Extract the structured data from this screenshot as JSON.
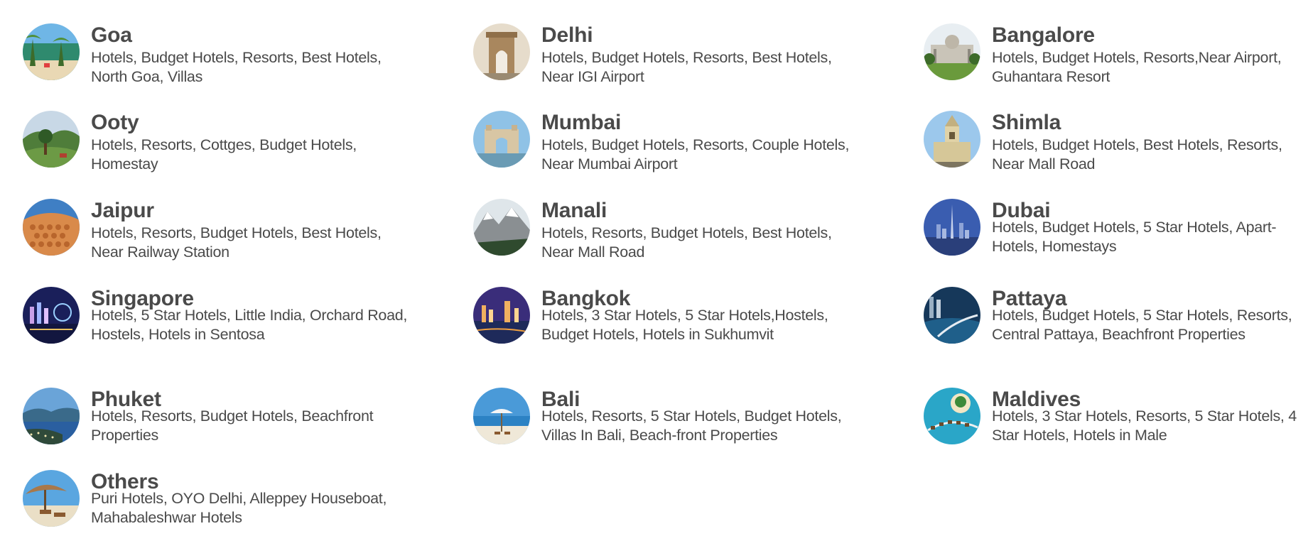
{
  "destinations": [
    {
      "name": "Goa",
      "links": "Hotels, Budget Hotels, Resorts, Best Hotels, North Goa, Villas"
    },
    {
      "name": "Delhi",
      "links": "Hotels, Budget Hotels, Resorts, Best Hotels, Near IGI Airport"
    },
    {
      "name": "Bangalore",
      "links": "Hotels, Budget Hotels, Resorts,Near Airport, Guhantara Resort"
    },
    {
      "name": "Ooty",
      "links": "Hotels, Resorts, Cottges, Budget Hotels, Homestay"
    },
    {
      "name": "Mumbai",
      "links": "Hotels, Budget Hotels, Resorts, Couple Hotels, Near Mumbai Airport"
    },
    {
      "name": "Shimla",
      "links": "Hotels, Budget Hotels, Best Hotels, Resorts, Near Mall Road"
    },
    {
      "name": "Jaipur",
      "links": "Hotels, Resorts, Budget Hotels, Best Hotels, Near Railway Station"
    },
    {
      "name": "Manali",
      "links": "Hotels, Resorts, Budget Hotels, Best Hotels, Near Mall Road"
    },
    {
      "name": "Dubai",
      "links": "Hotels, Budget Hotels, 5 Star Hotels, Apart-Hotels, Homestays"
    },
    {
      "name": "Singapore",
      "links": "Hotels, 5 Star Hotels, Little India, Orchard Road, Hostels, Hotels in Sentosa"
    },
    {
      "name": "Bangkok",
      "links": "Hotels, 3 Star Hotels, 5 Star Hotels,Hostels, Budget Hotels, Hotels in Sukhumvit"
    },
    {
      "name": "Pattaya",
      "links": "Hotels, Budget Hotels, 5 Star Hotels, Resorts, Central Pattaya, Beachfront Properties"
    },
    {
      "name": "Phuket",
      "links": "Hotels, Resorts, Budget Hotels, Beachfront Properties"
    },
    {
      "name": "Bali",
      "links": "Hotels, Resorts, 5 Star Hotels, Budget Hotels, Villas In Bali, Beach-front Properties"
    },
    {
      "name": "Maldives",
      "links": "Hotels, 3 Star Hotels, Resorts, 5 Star Hotels, 4 Star Hotels, Hotels in Male"
    },
    {
      "name": "Others",
      "links": "Puri Hotels, OYO Delhi, Alleppey Houseboat, Mahabaleshwar Hotels"
    }
  ],
  "colors": {
    "text": "#4a4a4a",
    "background": "#ffffff"
  },
  "icons": [
    "goa-beach-icon",
    "india-gate-icon",
    "palace-icon",
    "ooty-hills-icon",
    "gateway-of-india-icon",
    "shimla-church-icon",
    "hawa-mahal-icon",
    "snow-mountain-icon",
    "dubai-skyline-icon",
    "singapore-marina-icon",
    "bangkok-night-icon",
    "pattaya-coast-icon",
    "phuket-bay-icon",
    "bali-beach-icon",
    "maldives-island-icon",
    "beach-hut-icon"
  ]
}
